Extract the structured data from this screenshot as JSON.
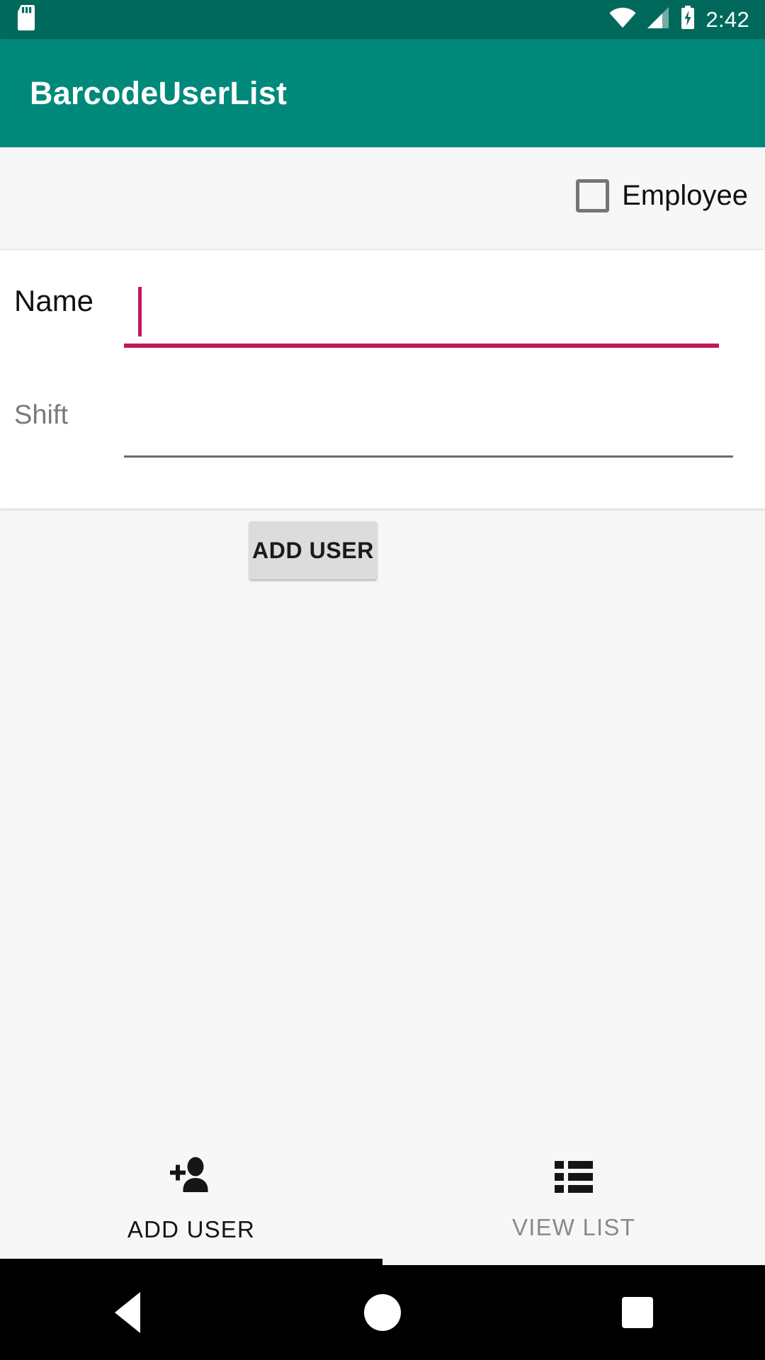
{
  "status_bar": {
    "time": "2:42",
    "icons": [
      "sd-card-icon",
      "wifi-icon",
      "cell-signal-icon",
      "battery-charging-icon"
    ],
    "background_color": "#00695C",
    "foreground_color": "#FFFFFF"
  },
  "app_bar": {
    "title": "BarcodeUserList",
    "background_color": "#00897B",
    "text_color": "#FFFFFF"
  },
  "form": {
    "employee_checkbox": {
      "label": "Employee",
      "checked": false
    },
    "fields": [
      {
        "label": "Name",
        "value": "",
        "placeholder": "",
        "focused": true,
        "accent_color": "#C2185B"
      },
      {
        "label": "Shift",
        "value": "",
        "placeholder": "Shift",
        "focused": false,
        "accent_color": "#6E6E6E"
      }
    ],
    "submit_button": {
      "label": "ADD USER",
      "background_color": "#DCDCDC",
      "text_color": "#1A1A1A"
    }
  },
  "tab_bar": {
    "active_index": 0,
    "indicator_color": "#000000",
    "tabs": [
      {
        "label": "ADD USER",
        "icon": "person-add-icon",
        "active": true
      },
      {
        "label": "VIEW LIST",
        "icon": "list-icon",
        "active": false
      }
    ]
  },
  "nav_bar": {
    "buttons": [
      {
        "name": "back-button",
        "icon": "triangle-back-icon"
      },
      {
        "name": "home-button",
        "icon": "circle-home-icon"
      },
      {
        "name": "recents-button",
        "icon": "square-recents-icon"
      }
    ],
    "background_color": "#000000"
  }
}
